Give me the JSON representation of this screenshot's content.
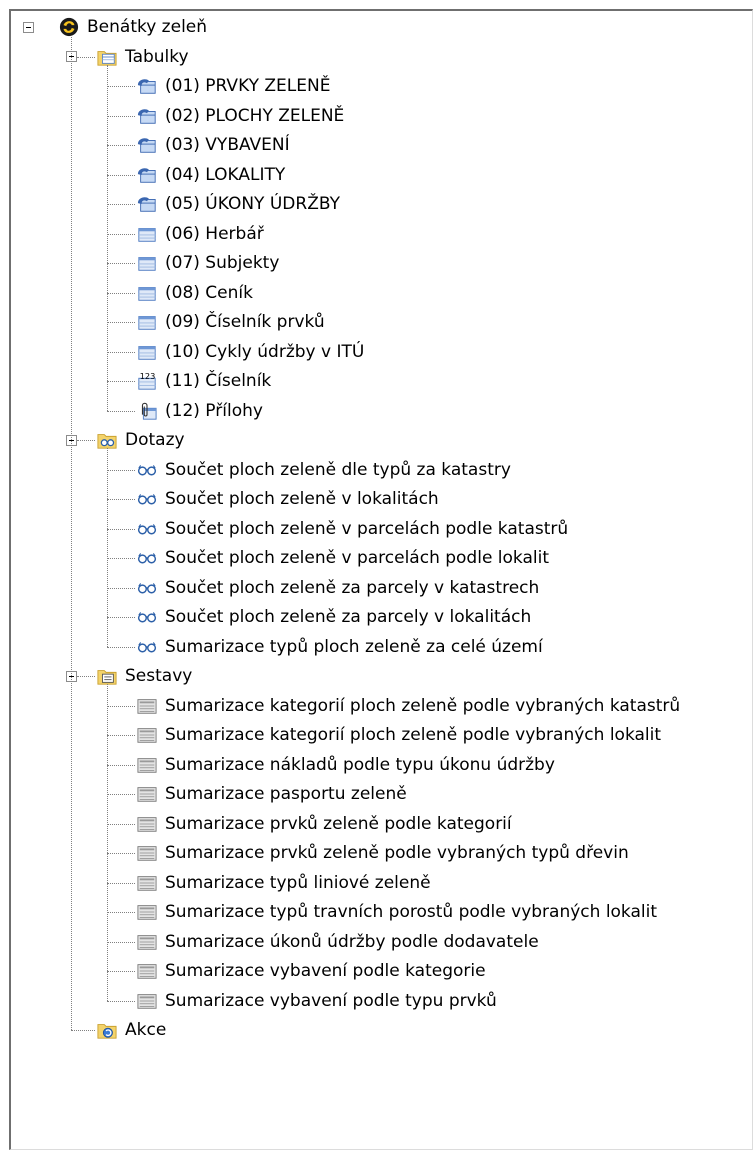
{
  "root": {
    "label": "Benátky zeleň",
    "icon": "app-logo-icon"
  },
  "groups": [
    {
      "key": "tabulky",
      "label": "Tabulky",
      "icon": "tables-folder-icon",
      "items": [
        {
          "label": "(01) PRVKY ZELENĚ",
          "icon": "linked-table-icon"
        },
        {
          "label": "(02) PLOCHY ZELENĚ",
          "icon": "linked-table-icon"
        },
        {
          "label": "(03) VYBAVENÍ",
          "icon": "linked-table-icon"
        },
        {
          "label": "(04) LOKALITY",
          "icon": "linked-table-icon"
        },
        {
          "label": "(05) ÚKONY ÚDRŽBY",
          "icon": "linked-table-icon"
        },
        {
          "label": "(06) Herbář",
          "icon": "table-icon"
        },
        {
          "label": "(07) Subjekty",
          "icon": "table-icon"
        },
        {
          "label": "(08) Ceník",
          "icon": "table-icon"
        },
        {
          "label": "(09) Číselník prvků",
          "icon": "table-icon"
        },
        {
          "label": "(10) Cykly údržby v ITÚ",
          "icon": "table-icon"
        },
        {
          "label": "(11) Číselník",
          "icon": "codebook-icon"
        },
        {
          "label": "(12) Přílohy",
          "icon": "attachment-icon"
        }
      ]
    },
    {
      "key": "dotazy",
      "label": "Dotazy",
      "icon": "queries-folder-icon",
      "items": [
        {
          "label": "Součet ploch zeleně dle typů za katastry",
          "icon": "query-icon"
        },
        {
          "label": "Součet ploch zeleně v lokalitách",
          "icon": "query-icon"
        },
        {
          "label": "Součet ploch zeleně v parcelách podle katastrů",
          "icon": "query-icon"
        },
        {
          "label": "Součet ploch zeleně v parcelách podle lokalit",
          "icon": "query-icon"
        },
        {
          "label": "Součet ploch zeleně za parcely v katastrech",
          "icon": "query-icon"
        },
        {
          "label": "Součet ploch zeleně za parcely v lokalitách",
          "icon": "query-icon"
        },
        {
          "label": "Sumarizace typů ploch zeleně za celé území",
          "icon": "query-icon"
        }
      ]
    },
    {
      "key": "sestavy",
      "label": "Sestavy",
      "icon": "reports-folder-icon",
      "items": [
        {
          "label": "Sumarizace kategorií ploch zeleně podle vybraných katastrů",
          "icon": "report-icon"
        },
        {
          "label": "Sumarizace kategorií ploch zeleně podle vybraných lokalit",
          "icon": "report-icon"
        },
        {
          "label": "Sumarizace nákladů podle typu úkonu údržby",
          "icon": "report-icon"
        },
        {
          "label": "Sumarizace pasportu zeleně",
          "icon": "report-icon"
        },
        {
          "label": "Sumarizace prvků zeleně podle kategorií",
          "icon": "report-icon"
        },
        {
          "label": "Sumarizace prvků zeleně podle vybraných typů dřevin",
          "icon": "report-icon"
        },
        {
          "label": "Sumarizace typů liniové zeleně",
          "icon": "report-icon"
        },
        {
          "label": "Sumarizace typů travních porostů podle vybraných lokalit",
          "icon": "report-icon"
        },
        {
          "label": "Sumarizace úkonů údržby podle dodavatele",
          "icon": "report-icon"
        },
        {
          "label": "Sumarizace vybavení podle kategorie",
          "icon": "report-icon"
        },
        {
          "label": "Sumarizace vybavení podle typu prvků",
          "icon": "report-icon"
        }
      ]
    }
  ],
  "actions": {
    "label": "Akce",
    "icon": "actions-folder-icon"
  },
  "colors": {
    "folder": "#f3d36b",
    "folder_dark": "#c9a02e",
    "table_blue": "#8fb4e3",
    "table_dark": "#3a66b0",
    "report_gray": "#b5b5b5",
    "query_blue": "#2b5fa8"
  }
}
